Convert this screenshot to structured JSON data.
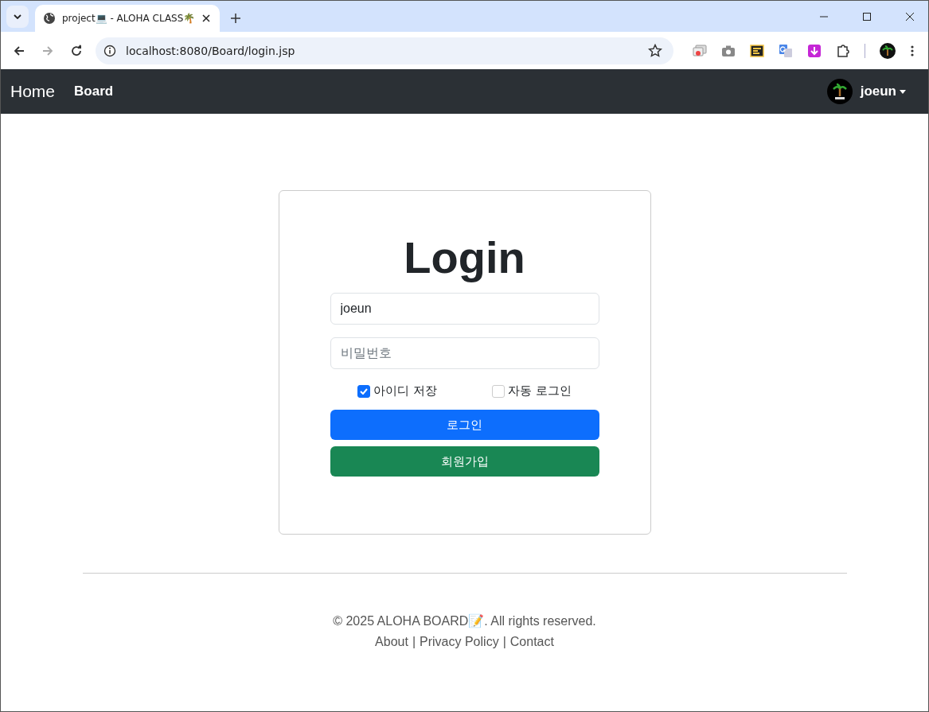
{
  "browser": {
    "tab": {
      "title": "project💻 - ALOHA CLASS🌴"
    },
    "address": "localhost:8080/Board/login.jsp"
  },
  "navbar": {
    "brand": "Home",
    "links": [
      "Board"
    ],
    "user": "joeun"
  },
  "login": {
    "title": "Login",
    "username": {
      "value": "joeun"
    },
    "password": {
      "placeholder": "비밀번호"
    },
    "options": [
      {
        "label": "아이디 저장",
        "checked": true
      },
      {
        "label": "자동 로그인",
        "checked": false
      }
    ],
    "buttons": [
      {
        "label": "로그인",
        "kind": "primary"
      },
      {
        "label": "회원가입",
        "kind": "success"
      }
    ]
  },
  "footer": {
    "copyright": "© 2025 ALOHA BOARD📝. All rights reserved.",
    "links": [
      "About",
      "Privacy Policy",
      "Contact"
    ],
    "separators": [
      "|",
      "|"
    ]
  }
}
